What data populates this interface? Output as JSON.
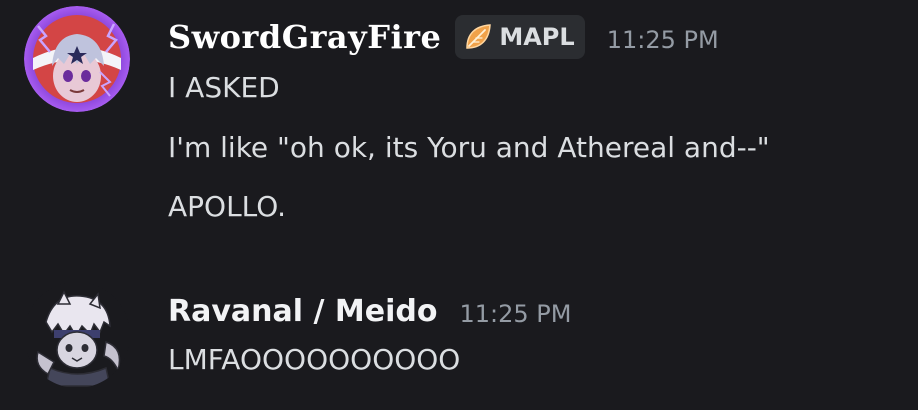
{
  "messages": [
    {
      "username": "SwordGrayFire",
      "tag": {
        "icon": "leaf-icon",
        "label": "MAPL",
        "color": "#f0a24a"
      },
      "timestamp": "11:25 PM",
      "avatar": "sword-gray-fire-avatar",
      "lines": [
        "I ASKED",
        "I'm like \"oh ok, its Yoru and Athereal and--\"",
        "APOLLO."
      ]
    },
    {
      "username": "Ravanal / Meido",
      "timestamp": "11:25 PM",
      "avatar": "ravanal-avatar",
      "lines": [
        "LMFAOOOOOOOOOO"
      ]
    }
  ],
  "colors": {
    "background": "#1a1a1e",
    "text": "#dbdee1",
    "username": "#ffffff",
    "timestamp": "#949ba4",
    "tag_background": "#2b2d31",
    "avatar_ring": "#8a4be0"
  }
}
